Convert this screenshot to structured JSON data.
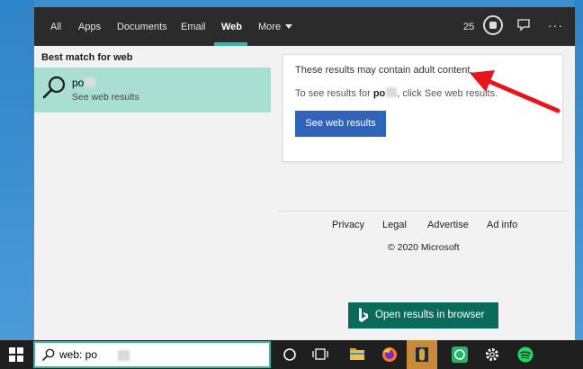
{
  "tabs": [
    {
      "label": "All"
    },
    {
      "label": "Apps"
    },
    {
      "label": "Documents"
    },
    {
      "label": "Email"
    },
    {
      "label": "Web"
    },
    {
      "label": "More"
    }
  ],
  "rewards_points": "25",
  "left": {
    "heading": "Best match for web",
    "result": {
      "title": "po",
      "subtitle": "See web results"
    }
  },
  "card": {
    "warning": "These results may contain adult content.",
    "line_prefix": "To see results for ",
    "line_query": "po",
    "line_suffix": ", click See web results.",
    "button_label": "See web results"
  },
  "footer": {
    "links": [
      "Privacy",
      "Legal",
      "Advertise",
      "Ad info"
    ],
    "copyright": "© 2020 Microsoft"
  },
  "open_browser_label": "Open results in browser",
  "taskbar": {
    "search_value": "web: po",
    "icons": [
      "windows-icon",
      "cortana-icon",
      "task-view-icon",
      "file-explorer-icon",
      "firefox-icon",
      "app-icon",
      "whatsapp-icon",
      "settings-icon",
      "spotify-icon"
    ]
  },
  "colors": {
    "accent": "#3bb3a5",
    "selected_result": "#a9ded3",
    "primary_button": "#2f64b8",
    "open_browser_button": "#0b6b5a",
    "annotation_arrow": "#e8141b"
  }
}
